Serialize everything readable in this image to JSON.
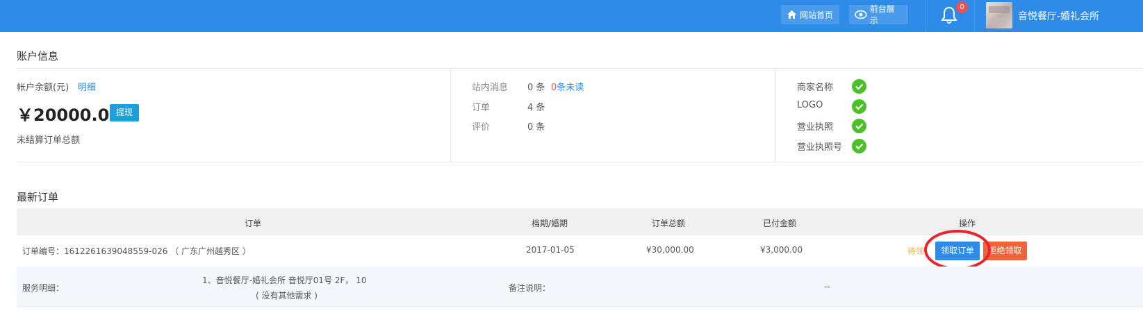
{
  "topbar": {
    "home_label": "网站首页",
    "front_label": "前台展示",
    "notification_count": "0",
    "shop_name": "音悦餐厅-婚礼会所"
  },
  "account": {
    "title": "账户信息",
    "balance_label": "帐户余额(元)",
    "detail_link": "明细",
    "balance": "￥20000.00",
    "withdraw_label": "提现",
    "unsettled_label": "未结算订单总额",
    "stats": [
      {
        "label": "站内消息",
        "value": "0 条",
        "unread_count": "0",
        "unread_text": "条未读"
      },
      {
        "label": "订单",
        "value": "4 条"
      },
      {
        "label": "评价",
        "value": "0 条"
      }
    ],
    "checks": [
      {
        "label": "商家名称"
      },
      {
        "label": "LOGO"
      },
      {
        "label": "营业执照"
      },
      {
        "label": "营业执照号"
      }
    ]
  },
  "orders": {
    "title": "最新订单",
    "columns": [
      "订单",
      "档期/婚期",
      "订单总额",
      "已付金额",
      "操作"
    ],
    "row": {
      "order_no": "订单编号：1612261639048559-026 （ 广东广州越秀区 ）",
      "date": "2017-01-05",
      "total": "¥30,000.00",
      "paid": "¥3,000.00",
      "status": "待领",
      "take_label": "领取订单",
      "reject_label": "拒绝领取"
    },
    "detail": {
      "service_label": "服务明细：",
      "service_line1": "1、音悦餐厅-婚礼会所 音悦厅01号 2F， 10",
      "service_line2": "( 没有其他需求 )",
      "remark_label": "备注说明：",
      "remark_value": "--"
    }
  },
  "colors": {
    "topbar": "#2f8be8",
    "check": "#4cc029",
    "reject": "#f0643c",
    "status": "#f0ad4e",
    "highlight_circle": "#e8242c"
  }
}
